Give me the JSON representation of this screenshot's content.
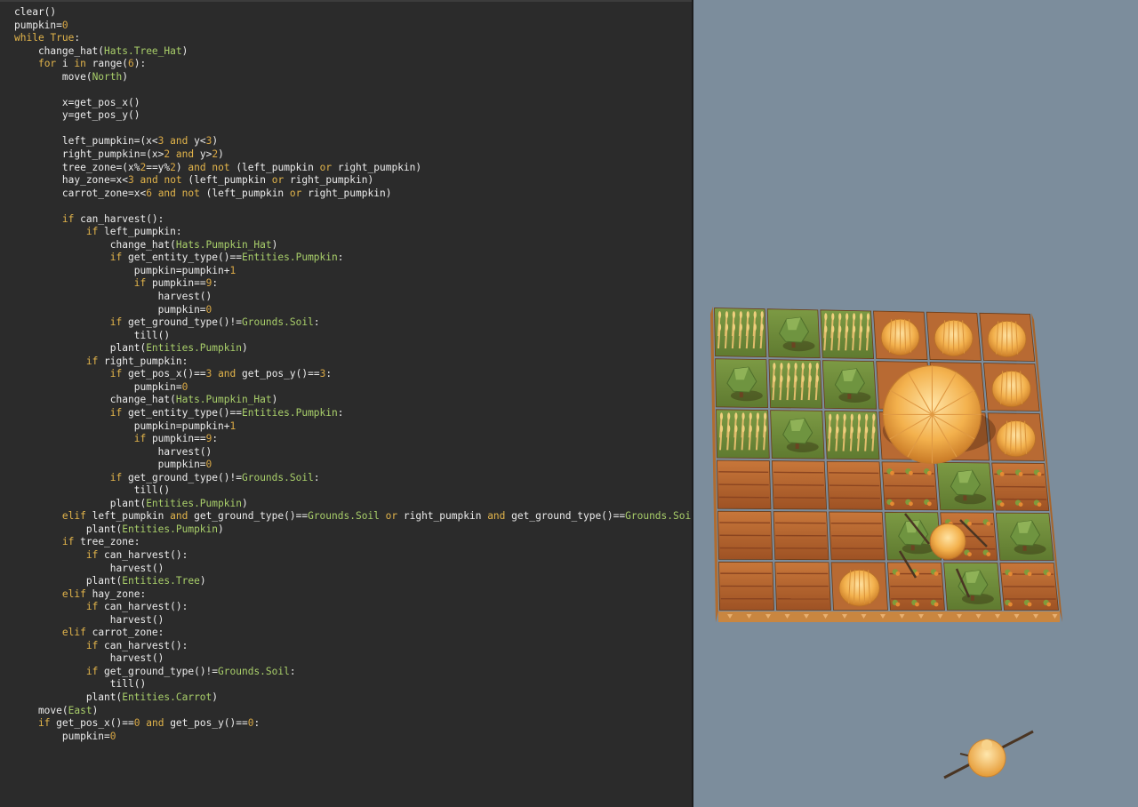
{
  "editor": {
    "lines": [
      "clear()",
      "pumpkin=0",
      "while True:",
      "    change_hat(Hats.Tree_Hat)",
      "    for i in range(6):",
      "        move(North)",
      "",
      "        x=get_pos_x()",
      "        y=get_pos_y()",
      "",
      "        left_pumpkin=(x<3 and y<3)",
      "        right_pumpkin=(x>2 and y>2)",
      "        tree_zone=(x%2==y%2) and not (left_pumpkin or right_pumpkin)",
      "        hay_zone=x<3 and not (left_pumpkin or right_pumpkin)",
      "        carrot_zone=x<6 and not (left_pumpkin or right_pumpkin)",
      "",
      "        if can_harvest():",
      "            if left_pumpkin:",
      "                change_hat(Hats.Pumpkin_Hat)",
      "                if get_entity_type()==Entities.Pumpkin:",
      "                    pumpkin=pumpkin+1",
      "                    if pumpkin==9:",
      "                        harvest()",
      "                        pumpkin=0",
      "                if get_ground_type()!=Grounds.Soil:",
      "                    till()",
      "                plant(Entities.Pumpkin)",
      "            if right_pumpkin:",
      "                if get_pos_x()==3 and get_pos_y()==3:",
      "                    pumpkin=0",
      "                change_hat(Hats.Pumpkin_Hat)",
      "                if get_entity_type()==Entities.Pumpkin:",
      "                    pumpkin=pumpkin+1",
      "                    if pumpkin==9:",
      "                        harvest()",
      "                        pumpkin=0",
      "                if get_ground_type()!=Grounds.Soil:",
      "                    till()",
      "                plant(Entities.Pumpkin)",
      "        elif left_pumpkin and get_ground_type()==Grounds.Soil or right_pumpkin and get_ground_type()==Grounds.Soil:",
      "            plant(Entities.Pumpkin)",
      "        if tree_zone:",
      "            if can_harvest():",
      "                harvest()",
      "            plant(Entities.Tree)",
      "        elif hay_zone:",
      "            if can_harvest():",
      "                harvest()",
      "        elif carrot_zone:",
      "            if can_harvest():",
      "                harvest()",
      "            if get_ground_type()!=Grounds.Soil:",
      "                till()",
      "            plant(Entities.Carrot)",
      "    move(East)",
      "    if get_pos_x()==0 and get_pos_y()==0:",
      "        pumpkin=0"
    ],
    "colors": {
      "background": "#2b2b2b",
      "text": "#ececec",
      "keyword": "#e3b54b",
      "number": "#d9a845",
      "entity": "#a9cf6a"
    }
  },
  "farm": {
    "colors": {
      "sky": "#7c8d9c",
      "grass": "#6f8a3a",
      "soil": "#b8672c",
      "pumpkin": "#f0b04a",
      "tree": "#6b8f3c",
      "hay": "#d8b060"
    },
    "grid_rows": [
      [
        "hay",
        "tree",
        "hay",
        "pumpkin",
        "pumpkin",
        "pumpkin"
      ],
      [
        "tree",
        "hay",
        "tree",
        "pumpkin-big",
        "pumpkin-big",
        "pumpkin"
      ],
      [
        "hay",
        "tree",
        "hay",
        "pumpkin-big",
        "pumpkin-big",
        "pumpkin"
      ],
      [
        "soil",
        "soil",
        "soil",
        "carrot",
        "tree",
        "carrot"
      ],
      [
        "soil",
        "soil",
        "soil",
        "tree",
        "carrot",
        "tree"
      ],
      [
        "soil",
        "soil",
        "pumpkin",
        "carrot",
        "tree",
        "carrot"
      ]
    ]
  }
}
